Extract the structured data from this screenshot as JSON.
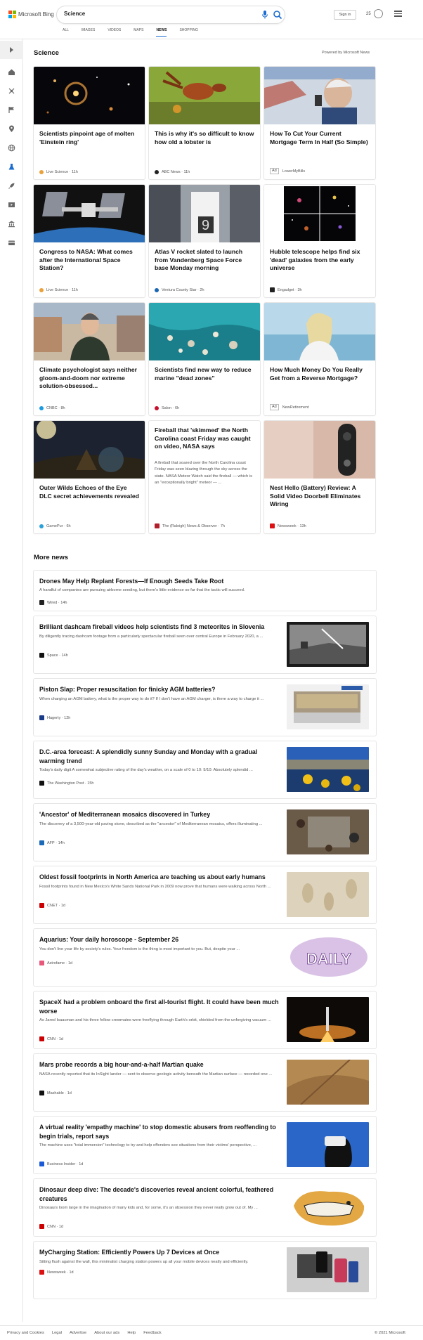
{
  "header": {
    "logo_text": "Microsoft Bing",
    "search_query": "Science",
    "sign_in": "Sign in",
    "points": "25",
    "tabs": [
      "ALL",
      "IMAGES",
      "VIDEOS",
      "MAPS",
      "NEWS",
      "SHOPPING"
    ],
    "active_tab": "NEWS"
  },
  "sidebar": {
    "icons": [
      "expand-arrow-icon",
      "home-icon",
      "discover-icon",
      "flag-icon",
      "location-pin-icon",
      "globe-icon",
      "science-icon",
      "rocket-icon",
      "video-icon",
      "bank-icon",
      "card-icon"
    ]
  },
  "science": {
    "heading": "Science",
    "powered_by": "Powered by Microsoft News",
    "cards": [
      {
        "title": "Scientists pinpoint age of molten 'Einstein ring'",
        "source": "Live Science",
        "time": "11h",
        "ad": false
      },
      {
        "title": "This is why it's so difficult to know how old a lobster is",
        "source": "ABC News",
        "time": "11h",
        "ad": false
      },
      {
        "title": "How To Cut Your Current Mortgage Term In Half (So Simple)",
        "source": "LowerMyBills",
        "time": "",
        "ad": true
      },
      {
        "title": "Congress to NASA: What comes after the International Space Station?",
        "source": "Live Science",
        "time": "11h",
        "ad": false
      },
      {
        "title": "Atlas V rocket slated to launch from Vandenberg Space Force base Monday morning",
        "source": "Ventura County Star",
        "time": "2h",
        "ad": false
      },
      {
        "title": "Hubble telescope helps find six 'dead' galaxies from the early universe",
        "source": "Engadget",
        "time": "3h",
        "ad": false
      },
      {
        "title": "Climate psychologist says neither gloom-and-doom nor extreme solution-obsessed...",
        "source": "CNBC",
        "time": "8h",
        "ad": false
      },
      {
        "title": "Scientists find new way to reduce marine \"dead zones\"",
        "source": "Salon",
        "time": "6h",
        "ad": false
      },
      {
        "title": "How Much Money Do You Really Get from a Reverse Mortgage?",
        "source": "NewRetirement",
        "time": "",
        "ad": true
      },
      {
        "title": "Outer Wilds Echoes of the Eye DLC secret achievements revealed",
        "source": "GamePur",
        "time": "6h",
        "ad": false
      },
      {
        "title": "Fireball that 'skimmed' the North Carolina coast Friday was caught on video, NASA says",
        "body": "A fireball that soared over the North Carolina coast Friday was seen blazing through the sky across the state. NASA Meteor Watch said the fireball — which is an \"exceptionally bright\" meteor — ...",
        "source": "The (Raleigh) News & Observer",
        "time": "7h",
        "ad": false
      },
      {
        "title": "Nest Hello (Battery) Review: A Solid Video Doorbell Eliminates Wiring",
        "source": "Newsweek",
        "time": "13h",
        "ad": false
      }
    ]
  },
  "more_news": {
    "heading": "More news",
    "items": [
      {
        "title": "Drones May Help Replant Forests—If Enough Seeds Take Root",
        "desc": "A handful of companies are pursuing airborne seeding, but there's little evidence so far that the tactic will succeed.",
        "source": "Wired",
        "time": "14h"
      },
      {
        "title": "Brilliant dashcam fireball videos help scientists find 3 meteorites in Slovenia",
        "desc": "By diligently tracing dashcam footage from a particularly spectacular fireball seen over central Europe in February 2020, a ...",
        "source": "Space",
        "time": "14h"
      },
      {
        "title": "Piston Slap: Proper resuscitation for finicky AGM batteries?",
        "desc": "When charging an AGM battery, what is the proper way to do it? If I don't have an AGM charger, is there a way to charge it ...",
        "source": "Hagerty",
        "time": "12h"
      },
      {
        "title": "D.C.-area forecast: A splendidly sunny Sunday and Monday with a gradual warming trend",
        "desc": "Today's daily digit A somewhat subjective rating of the day's weather, on a scale of 0 to 10: 9/10: Absolutely splendid ...",
        "source": "The Washington Post",
        "time": "15h"
      },
      {
        "title": "'Ancestor' of Mediterranean mosaics discovered in Turkey",
        "desc": "The discovery of a 3,500-year-old paving stone, described as the \"ancestor\" of Mediterranean mosaics, offers illuminating ...",
        "source": "AFP",
        "time": "14h"
      },
      {
        "title": "Oldest fossil footprints in North America are teaching us about early humans",
        "desc": "Fossil footprints found in New Mexico's White Sands National Park in 2009 now prove that humans were walking across North ...",
        "source": "CNET",
        "time": "1d"
      },
      {
        "title": "Aquarius: Your daily horoscope - September 26",
        "desc": "You don't live your life by society's rules. Your freedom is the thing is most important to you. But, despite your ...",
        "source": "Astrofame",
        "time": "1d"
      },
      {
        "title": "SpaceX had a problem onboard the first all-tourist flight. It could have been much worse",
        "desc": "As Jared Isaacman and his three fellow crewmates were freeflying through Earth's orbit, shielded from the unforgiving vacuum ...",
        "source": "CNN",
        "time": "1d"
      },
      {
        "title": "Mars probe records a big hour-and-a-half Martian quake",
        "desc": "NASA recently reported that its InSight lander — sent to observe geologic activity beneath the Martian surface — recorded one ...",
        "source": "Mashable",
        "time": "1d"
      },
      {
        "title": "A virtual reality 'empathy machine' to stop domestic abusers from reoffending to begin trials, report says",
        "desc": "The machine uses \"total immersion\" technology to try and help offenders see situations from their victims' perspective, ...",
        "source": "Business Insider",
        "time": "1d"
      },
      {
        "title": "Dinosaur deep dive: The decade's discoveries reveal ancient colorful, feathered creatures",
        "desc": "Dinosaurs loom large in the imagination of many kids and, for some, it's an obsession they never really grow out of. My ...",
        "source": "CNN",
        "time": "1d"
      },
      {
        "title": "MyCharging Station: Efficiently Powers Up 7 Devices at Once",
        "desc": "Sitting flush against the wall, this minimalist charging station powers up all your mobile devices neatly and efficiently.",
        "source": "Newsweek",
        "time": "1d"
      }
    ],
    "thumb_labels": {
      "daily": "DAILY"
    }
  },
  "footer": {
    "links": [
      "Privacy and Cookies",
      "Legal",
      "Advertise",
      "About our ads",
      "Help",
      "Feedback"
    ],
    "copyright": "© 2021 Microsoft"
  },
  "colors": {
    "accent": "#1c6dd0",
    "logo": [
      "#f25022",
      "#7fba00",
      "#00a4ef",
      "#ffb900"
    ]
  }
}
